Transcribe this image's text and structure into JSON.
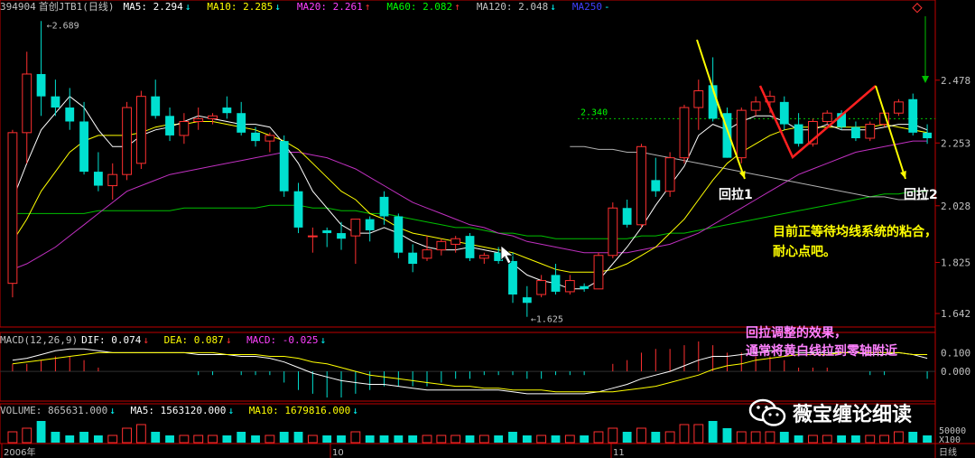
{
  "header": {
    "code": "394904",
    "name": "首创JTB1(日线)",
    "ma": [
      {
        "label": "MA5: 2.294",
        "arrow": "↓",
        "color": "#ffffff"
      },
      {
        "label": "MA10: 2.285",
        "arrow": "↓",
        "color": "#ffff00"
      },
      {
        "label": "MA20: 2.261",
        "arrow": "↑",
        "color": "#ff40ff"
      },
      {
        "label": "MA60: 2.082",
        "arrow": "↑",
        "color": "#00ff00"
      },
      {
        "label": "MA120: 2.048",
        "arrow": "↓",
        "color": "#c0c0c0"
      },
      {
        "label": "MA250",
        "arrow": "-",
        "color": "#4040ff"
      }
    ]
  },
  "macd_header": {
    "name": "MACD(12,26,9)",
    "dif": "DIF: 0.074",
    "dea": "DEA: 0.087",
    "macd": "MACD: -0.025"
  },
  "volume_header": {
    "vol": "VOLUME: 865631.000",
    "ma5": "MA5: 1563120.000",
    "ma10": "MA10: 1679816.000"
  },
  "annotations": {
    "pullback1": "回拉1",
    "pullback2": "回拉2",
    "note_yellow_line1": "目前正等待均线系统的粘合，",
    "note_yellow_line2": "耐心点吧。",
    "note_pink_line1": "回拉调整的效果，",
    "note_pink_line2": "通常将黄白线拉到零轴附近"
  },
  "watermark": "薇宝缠论细读",
  "colors": {
    "up": "#ff3030",
    "down": "#00e0d0",
    "ma5": "#ffffff",
    "ma10": "#ffff00",
    "ma20": "#c030c0",
    "ma60": "#00c000",
    "ma120": "#b0b0b0",
    "axis": "#c00000"
  },
  "chart_data": {
    "type": "candlestick",
    "y_ticks": [
      "2.478",
      "2.253",
      "2.028",
      "1.825",
      "1.642"
    ],
    "macd_ticks": [
      "0.100",
      "0.000"
    ],
    "volume_ticks": [
      "50000",
      "X100"
    ],
    "x_labels": [
      "2006年",
      "10",
      "11",
      "日线"
    ],
    "high_label": "2.689",
    "low_label": "1.625",
    "ref_level_label": "2.340",
    "ylim": [
      1.6,
      2.72
    ],
    "candles": [
      [
        1.75,
        2.3,
        1.7,
        2.29
      ],
      [
        2.29,
        2.58,
        2.18,
        2.5
      ],
      [
        2.5,
        2.69,
        2.35,
        2.42
      ],
      [
        2.42,
        2.48,
        2.35,
        2.38
      ],
      [
        2.38,
        2.45,
        2.3,
        2.33
      ],
      [
        2.33,
        2.4,
        2.14,
        2.15
      ],
      [
        2.15,
        2.22,
        2.08,
        2.1
      ],
      [
        2.1,
        2.18,
        2.05,
        2.14
      ],
      [
        2.14,
        2.4,
        2.12,
        2.38
      ],
      [
        2.18,
        2.44,
        2.16,
        2.42
      ],
      [
        2.42,
        2.48,
        2.34,
        2.35
      ],
      [
        2.35,
        2.38,
        2.26,
        2.28
      ],
      [
        2.28,
        2.36,
        2.25,
        2.33
      ],
      [
        2.33,
        2.38,
        2.3,
        2.34
      ],
      [
        2.34,
        2.36,
        2.32,
        2.35
      ],
      [
        2.38,
        2.42,
        2.34,
        2.36
      ],
      [
        2.36,
        2.4,
        2.28,
        2.29
      ],
      [
        2.29,
        2.31,
        2.24,
        2.26
      ],
      [
        2.26,
        2.29,
        2.22,
        2.28
      ],
      [
        2.26,
        2.28,
        2.06,
        2.08
      ],
      [
        2.08,
        2.11,
        1.93,
        1.95
      ],
      [
        1.92,
        1.95,
        1.86,
        1.92
      ],
      [
        1.94,
        1.95,
        1.88,
        1.93
      ],
      [
        1.93,
        1.97,
        1.87,
        1.91
      ],
      [
        1.92,
        1.98,
        1.82,
        1.98
      ],
      [
        1.98,
        1.99,
        1.9,
        1.94
      ],
      [
        2.06,
        2.08,
        1.96,
        1.99
      ],
      [
        1.99,
        2.0,
        1.84,
        1.86
      ],
      [
        1.86,
        1.89,
        1.79,
        1.82
      ],
      [
        1.84,
        1.92,
        1.83,
        1.87
      ],
      [
        1.87,
        1.91,
        1.85,
        1.9
      ],
      [
        1.89,
        1.92,
        1.86,
        1.91
      ],
      [
        1.92,
        1.93,
        1.83,
        1.84
      ],
      [
        1.84,
        1.86,
        1.82,
        1.85
      ],
      [
        1.86,
        1.88,
        1.82,
        1.83
      ],
      [
        1.83,
        1.86,
        1.68,
        1.71
      ],
      [
        1.7,
        1.74,
        1.63,
        1.68
      ],
      [
        1.71,
        1.78,
        1.7,
        1.76
      ],
      [
        1.78,
        1.82,
        1.71,
        1.72
      ],
      [
        1.72,
        1.78,
        1.71,
        1.76
      ],
      [
        1.74,
        1.75,
        1.72,
        1.73
      ],
      [
        1.73,
        1.86,
        1.73,
        1.85
      ],
      [
        1.85,
        2.04,
        1.84,
        2.02
      ],
      [
        2.02,
        2.05,
        1.95,
        1.96
      ],
      [
        1.96,
        2.25,
        1.95,
        2.24
      ],
      [
        2.12,
        2.2,
        2.06,
        2.08
      ],
      [
        2.08,
        2.22,
        2.06,
        2.2
      ],
      [
        2.2,
        2.39,
        2.18,
        2.38
      ],
      [
        2.38,
        2.48,
        2.3,
        2.44
      ],
      [
        2.46,
        2.56,
        2.33,
        2.34
      ],
      [
        2.36,
        2.38,
        2.2,
        2.2
      ],
      [
        2.2,
        2.38,
        2.18,
        2.37
      ],
      [
        2.37,
        2.42,
        2.35,
        2.4
      ],
      [
        2.4,
        2.44,
        2.36,
        2.42
      ],
      [
        2.4,
        2.42,
        2.3,
        2.32
      ],
      [
        2.32,
        2.36,
        2.24,
        2.25
      ],
      [
        2.25,
        2.34,
        2.24,
        2.33
      ],
      [
        2.33,
        2.37,
        2.32,
        2.36
      ],
      [
        2.36,
        2.37,
        2.3,
        2.31
      ],
      [
        2.31,
        2.33,
        2.26,
        2.27
      ],
      [
        2.27,
        2.33,
        2.26,
        2.32
      ],
      [
        2.32,
        2.37,
        2.31,
        2.36
      ],
      [
        2.36,
        2.41,
        2.35,
        2.4
      ],
      [
        2.41,
        2.43,
        2.28,
        2.29
      ],
      [
        2.29,
        2.32,
        2.25,
        2.27
      ]
    ],
    "ma5": [
      2.05,
      2.18,
      2.3,
      2.36,
      2.42,
      2.38,
      2.3,
      2.24,
      2.24,
      2.28,
      2.3,
      2.31,
      2.33,
      2.35,
      2.34,
      2.33,
      2.32,
      2.32,
      2.31,
      2.25,
      2.18,
      2.08,
      2.02,
      1.96,
      1.93,
      1.93,
      1.95,
      1.93,
      1.9,
      1.88,
      1.87,
      1.87,
      1.88,
      1.87,
      1.86,
      1.82,
      1.78,
      1.76,
      1.75,
      1.73,
      1.73,
      1.76,
      1.82,
      1.88,
      1.95,
      2.03,
      2.1,
      2.17,
      2.28,
      2.32,
      2.3,
      2.33,
      2.35,
      2.35,
      2.33,
      2.3,
      2.3,
      2.32,
      2.3,
      2.3,
      2.3,
      2.31,
      2.32,
      2.32,
      2.3
    ],
    "ma10": [
      1.9,
      1.98,
      2.08,
      2.15,
      2.22,
      2.26,
      2.28,
      2.28,
      2.28,
      2.29,
      2.31,
      2.32,
      2.32,
      2.33,
      2.33,
      2.32,
      2.31,
      2.3,
      2.28,
      2.26,
      2.23,
      2.18,
      2.13,
      2.08,
      2.05,
      2.0,
      1.98,
      1.95,
      1.93,
      1.92,
      1.91,
      1.9,
      1.89,
      1.88,
      1.87,
      1.86,
      1.84,
      1.82,
      1.8,
      1.79,
      1.79,
      1.79,
      1.8,
      1.82,
      1.85,
      1.88,
      1.93,
      1.98,
      2.05,
      2.12,
      2.18,
      2.22,
      2.25,
      2.28,
      2.3,
      2.31,
      2.31,
      2.31,
      2.31,
      2.31,
      2.31,
      2.32,
      2.31,
      2.3,
      2.29
    ],
    "ma20": [
      1.8,
      1.82,
      1.85,
      1.88,
      1.92,
      1.96,
      2.0,
      2.04,
      2.08,
      2.1,
      2.12,
      2.14,
      2.15,
      2.16,
      2.17,
      2.18,
      2.19,
      2.2,
      2.21,
      2.22,
      2.22,
      2.21,
      2.2,
      2.18,
      2.16,
      2.13,
      2.1,
      2.07,
      2.04,
      2.02,
      2.0,
      1.98,
      1.96,
      1.95,
      1.93,
      1.92,
      1.9,
      1.89,
      1.88,
      1.87,
      1.86,
      1.86,
      1.86,
      1.86,
      1.87,
      1.88,
      1.89,
      1.91,
      1.93,
      1.96,
      1.99,
      2.02,
      2.05,
      2.08,
      2.11,
      2.14,
      2.16,
      2.18,
      2.2,
      2.22,
      2.23,
      2.24,
      2.25,
      2.26,
      2.26
    ],
    "ma60": [
      2.0,
      2.0,
      2.0,
      2.0,
      2.0,
      2.0,
      2.01,
      2.01,
      2.01,
      2.01,
      2.01,
      2.01,
      2.02,
      2.02,
      2.02,
      2.02,
      2.02,
      2.02,
      2.03,
      2.03,
      2.03,
      2.02,
      2.02,
      2.01,
      2.01,
      2.0,
      2.0,
      1.99,
      1.98,
      1.97,
      1.96,
      1.95,
      1.95,
      1.94,
      1.93,
      1.93,
      1.92,
      1.92,
      1.91,
      1.91,
      1.91,
      1.91,
      1.91,
      1.91,
      1.92,
      1.92,
      1.93,
      1.93,
      1.94,
      1.95,
      1.96,
      1.97,
      1.98,
      1.99,
      2.0,
      2.01,
      2.02,
      2.03,
      2.04,
      2.05,
      2.06,
      2.07,
      2.07,
      2.08,
      2.08
    ],
    "ma120": [
      2.24,
      2.24,
      2.23,
      2.23,
      2.22,
      2.22,
      2.21,
      2.2,
      2.19,
      2.18,
      2.17,
      2.16,
      2.15,
      2.14,
      2.13,
      2.12,
      2.11,
      2.1,
      2.09,
      2.08,
      2.07,
      2.06,
      2.06,
      2.05,
      2.05,
      2.05
    ],
    "macd_dif": [
      0.06,
      0.07,
      0.09,
      0.11,
      0.12,
      0.12,
      0.11,
      0.1,
      0.1,
      0.1,
      0.1,
      0.1,
      0.1,
      0.09,
      0.09,
      0.09,
      0.08,
      0.08,
      0.07,
      0.05,
      0.02,
      -0.01,
      -0.03,
      -0.05,
      -0.06,
      -0.07,
      -0.07,
      -0.08,
      -0.09,
      -0.1,
      -0.1,
      -0.1,
      -0.1,
      -0.1,
      -0.1,
      -0.11,
      -0.12,
      -0.12,
      -0.12,
      -0.12,
      -0.12,
      -0.11,
      -0.09,
      -0.07,
      -0.04,
      -0.02,
      0.0,
      0.03,
      0.06,
      0.08,
      0.08,
      0.09,
      0.1,
      0.11,
      0.11,
      0.1,
      0.1,
      0.1,
      0.1,
      0.1,
      0.09,
      0.09,
      0.1,
      0.09,
      0.07
    ],
    "macd_dea": [
      0.04,
      0.05,
      0.06,
      0.07,
      0.08,
      0.09,
      0.1,
      0.1,
      0.1,
      0.1,
      0.1,
      0.1,
      0.1,
      0.1,
      0.1,
      0.09,
      0.09,
      0.09,
      0.08,
      0.08,
      0.07,
      0.05,
      0.04,
      0.02,
      0.0,
      -0.02,
      -0.03,
      -0.04,
      -0.05,
      -0.06,
      -0.07,
      -0.08,
      -0.08,
      -0.09,
      -0.09,
      -0.1,
      -0.1,
      -0.1,
      -0.11,
      -0.11,
      -0.11,
      -0.11,
      -0.11,
      -0.1,
      -0.09,
      -0.08,
      -0.06,
      -0.04,
      -0.02,
      0.01,
      0.03,
      0.04,
      0.06,
      0.07,
      0.08,
      0.09,
      0.09,
      0.09,
      0.1,
      0.1,
      0.1,
      0.1,
      0.1,
      0.09,
      0.09
    ],
    "volume": [
      3,
      4,
      6,
      3,
      2,
      3,
      2,
      2,
      4,
      5,
      3,
      2,
      2,
      2,
      2,
      2,
      3,
      2,
      2,
      3,
      3,
      2,
      2,
      2,
      3,
      2,
      2,
      2,
      2,
      2,
      2,
      2,
      2,
      2,
      2,
      3,
      2,
      2,
      2,
      2,
      2,
      3,
      4,
      3,
      4,
      3,
      3,
      5,
      5,
      6,
      4,
      3,
      3,
      3,
      3,
      2,
      2,
      2,
      2,
      2,
      2,
      2,
      3,
      3,
      2
    ],
    "ref_level": 2.34
  }
}
